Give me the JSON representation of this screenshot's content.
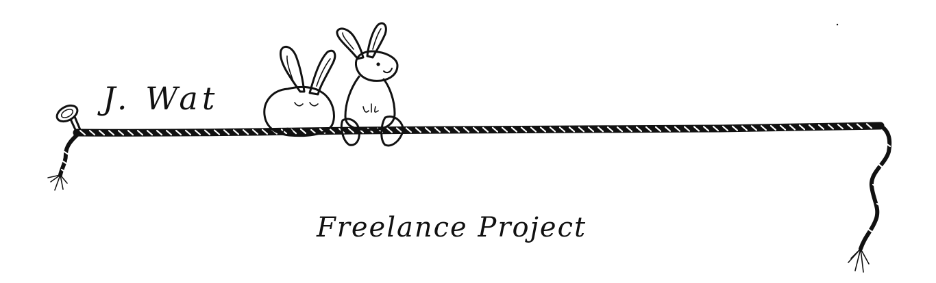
{
  "brand": {
    "signature": "J. Wat",
    "subtitle": "Freelance Project"
  },
  "illustration": {
    "characters": [
      "bunny-sitting-back",
      "bunny-sitting-front"
    ],
    "ink_color": "#111111",
    "background_color": "#ffffff"
  }
}
